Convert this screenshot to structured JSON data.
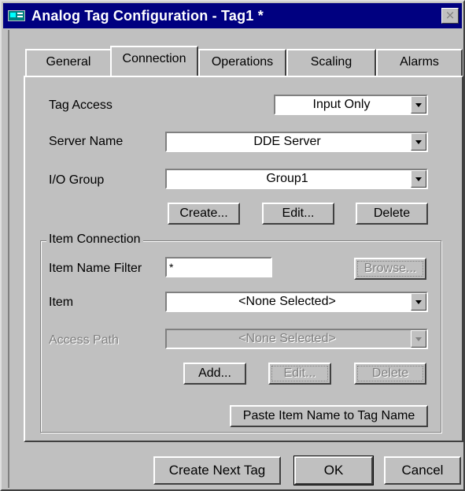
{
  "window": {
    "title": "Analog Tag Configuration - Tag1 *",
    "close_glyph": "×"
  },
  "tabs": [
    {
      "label": "General",
      "active": false
    },
    {
      "label": "Connection",
      "active": true
    },
    {
      "label": "Operations",
      "active": false
    },
    {
      "label": "Scaling",
      "active": false
    },
    {
      "label": "Alarms",
      "active": false
    }
  ],
  "connection": {
    "tag_access": {
      "label": "Tag Access",
      "value": "Input Only"
    },
    "server_name": {
      "label": "Server Name",
      "value": "DDE Server"
    },
    "io_group": {
      "label": "I/O Group",
      "value": "Group1"
    },
    "group_buttons": {
      "create": "Create...",
      "edit": "Edit...",
      "delete": "Delete"
    },
    "item_connection": {
      "title": "Item Connection",
      "item_name_filter": {
        "label": "Item Name Filter",
        "value": "*"
      },
      "browse_button": "Browse...",
      "item": {
        "label": "Item",
        "value": "<None Selected>"
      },
      "access_path": {
        "label": "Access Path",
        "value": "<None Selected>"
      },
      "add_button": "Add...",
      "edit_button": "Edit...",
      "delete_button": "Delete",
      "paste_button": "Paste Item Name to Tag Name"
    }
  },
  "footer": {
    "create_next_tag": "Create Next Tag",
    "ok": "OK",
    "cancel": "Cancel"
  },
  "colors": {
    "titlebar": "#000080",
    "face": "#c0c0c0",
    "disabled_text": "#808080"
  }
}
